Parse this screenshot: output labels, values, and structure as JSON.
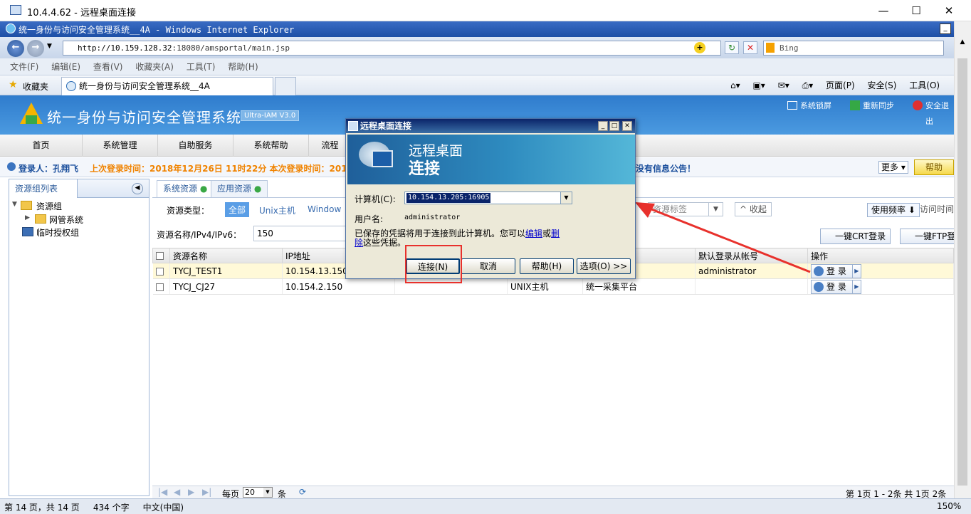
{
  "rdp_window": {
    "title": "10.4.4.62 - 远程桌面连接",
    "min": "—",
    "max": "☐",
    "close": "✕"
  },
  "ie": {
    "title": "统一身份与访问安全管理系统__4A - Windows Internet Explorer",
    "url_host": "http://10.159.128.32",
    "url_rest": ":18080/amsportal/main.jsp",
    "search_placeholder": "Bing",
    "menu": [
      "文件(F)",
      "编辑(E)",
      "查看(V)",
      "收藏夹(A)",
      "工具(T)",
      "帮助(H)"
    ],
    "favorites_label": "收藏夹",
    "tab_title": "统一身份与访问安全管理系统__4A",
    "tools": [
      "页面(P)",
      "安全(S)",
      "工具(O)"
    ]
  },
  "app": {
    "title": "统一身份与访问安全管理系统",
    "version": "Ultra-IAM V3.0",
    "header_buttons": [
      "系统锁屏",
      "重新同步",
      "安全退出"
    ],
    "nav": [
      "首页",
      "系统管理",
      "自助服务",
      "系统帮助",
      "流程"
    ],
    "user_label": "登录人：孔翔飞",
    "login_info": "上次登录时间：2018年12月26日 11时22分 本次登录时间：2018年",
    "notice": "没有信息公告！",
    "more": "更多",
    "help": "帮助"
  },
  "tree": {
    "header": "资源组列表",
    "items": [
      "资源组",
      "网管系统",
      "临时授权组"
    ]
  },
  "content": {
    "tabs": [
      "系统资源",
      "应用资源"
    ],
    "filter_label": "资源类型：",
    "filters": [
      "全部",
      "Unix主机",
      "Window"
    ],
    "tag_placeholder": "资源标签",
    "collapse": "收起",
    "sort_label": "使用频率",
    "sort_label2": "访问时间",
    "search_label": "资源名称/IPv4/IPv6：",
    "search_value": "150",
    "crt_button": "一键CRT登录",
    "ftp_button": "一键FTP登",
    "columns": [
      "资源名称",
      "IP地址",
      "",
      "",
      "",
      "默认登录从帐号",
      "操作"
    ],
    "rows": [
      {
        "name": "TYCJ_TEST1",
        "ip": "10.154.13.150",
        "c3": "",
        "type": "",
        "platform": "",
        "account": "administrator",
        "action": "登 录"
      },
      {
        "name": "TYCJ_CJ27",
        "ip": "10.154.2.150",
        "c3": "",
        "type": "UNIX主机",
        "platform": "统一采集平台",
        "account": "",
        "action": "登 录"
      }
    ],
    "pager": {
      "per_page_label": "每页",
      "per_page": "20",
      "unit": "条",
      "summary": "第 1页 1 - 2条 共 1页 2条"
    }
  },
  "status_bar": {
    "left": "第 14 页，共 14 页     434 个字     中文(中国)",
    "zoom": "150%"
  },
  "dialog": {
    "title": "远程桌面连接",
    "banner_line1": "远程桌面",
    "banner_line2": "连接",
    "computer_label": "计算机(C):",
    "computer_value": "10.154.13.205:16905",
    "user_label": "用户名:",
    "user_value": "administrator",
    "saved_text1": "已保存的凭据将用于连接到此计算机。您可以",
    "edit_link": "编辑",
    "or": "或",
    "delete_link": "删除",
    "saved_text2": "这些凭据。",
    "buttons": [
      "连接(N)",
      "取消",
      "帮助(H)",
      "选项(O) >>"
    ]
  },
  "colors": {
    "annotation": "#e8312c",
    "app_header": "#2f7ccd",
    "orange_text": "#f08300"
  }
}
